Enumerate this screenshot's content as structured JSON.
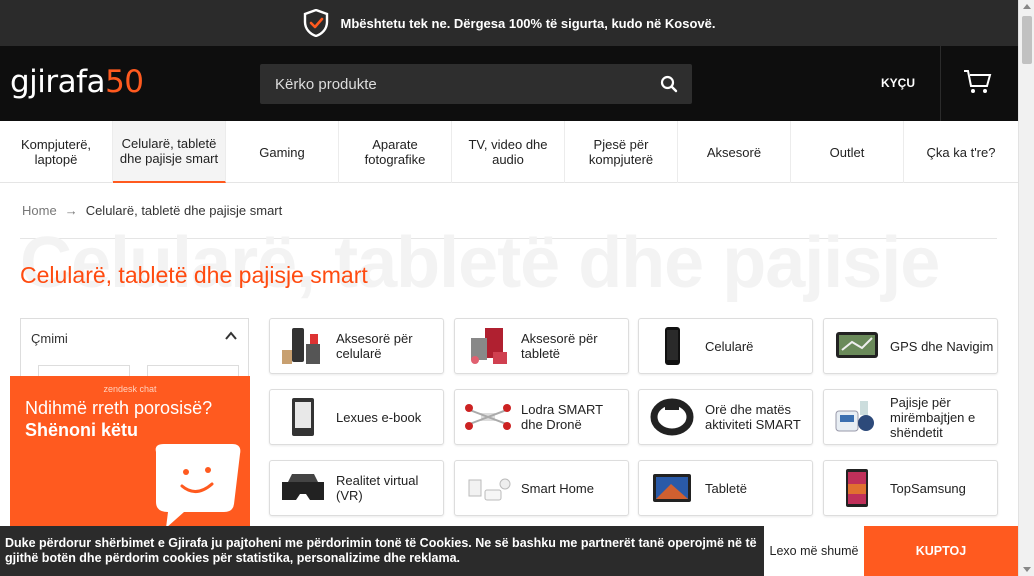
{
  "topbar": {
    "message": "Mbështetu tek ne. Dërgesa 100% të sigurta, kudo në Kosovë.",
    "icon": "shield-check-icon"
  },
  "header": {
    "logo_text": "gjirafa",
    "logo_num": "50",
    "search_placeholder": "Kërko produkte",
    "login_label": "KYÇU",
    "accent_color": "#ff5a1f"
  },
  "nav": {
    "items": [
      {
        "label": "Kompjuterë, laptopë"
      },
      {
        "label": "Celularë, tabletë dhe pajisje smart"
      },
      {
        "label": "Gaming"
      },
      {
        "label": "Aparate fotografike"
      },
      {
        "label": "TV, video dhe audio"
      },
      {
        "label": "Pjesë për kompjuterë"
      },
      {
        "label": "Aksesorë"
      },
      {
        "label": "Outlet"
      },
      {
        "label": "Çka ka t're?"
      }
    ]
  },
  "breadcrumb": {
    "home": "Home",
    "separator": "→",
    "current": "Celularë, tabletë dhe pajisje smart"
  },
  "page": {
    "title": "Celularë, tabletë dhe pajisje smart",
    "background_title": "Celularë, tabletë dhe pajisje"
  },
  "filter": {
    "heading": "Çmimi"
  },
  "categories": [
    {
      "label": "Aksesorë për celularë"
    },
    {
      "label": "Aksesorë për tabletë"
    },
    {
      "label": "Celularë"
    },
    {
      "label": "GPS dhe Navigim"
    },
    {
      "label": "Lexues e-book"
    },
    {
      "label": "Lodra SMART dhe Dronë"
    },
    {
      "label": "Orë dhe matës aktiviteti SMART"
    },
    {
      "label": "Pajisje për mirëmbajtjen e shëndetit"
    },
    {
      "label": "Realitet virtual (VR)"
    },
    {
      "label": "Smart Home"
    },
    {
      "label": "Tabletë"
    },
    {
      "label": "TopSamsung"
    }
  ],
  "chat": {
    "brand": "zendesk chat",
    "line1": "Ndihmë rreth porosisë?",
    "line2": "Shënoni këtu"
  },
  "cookie": {
    "text": "Duke përdorur shërbimet e Gjirafa ju pajtoheni me përdorimin tonë të Cookies. Ne së bashku me partnerët tanë operojmë në të gjithë botën dhe përdorim cookies për statistika, personalizime dhe reklama.",
    "more_label": "Lexo më shumë",
    "accept_label": "KUPTOJ"
  }
}
